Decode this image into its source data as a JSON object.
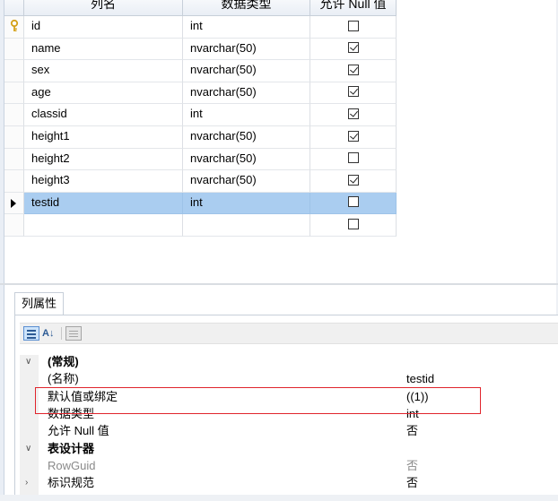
{
  "columns_grid": {
    "headers": {
      "name": "列名",
      "type": "数据类型",
      "nullable": "允许 Null 值"
    },
    "rows": [
      {
        "name": "id",
        "type": "int",
        "allow_null": false,
        "primary_key": true
      },
      {
        "name": "name",
        "type": "nvarchar(50)",
        "allow_null": true
      },
      {
        "name": "sex",
        "type": "nvarchar(50)",
        "allow_null": true
      },
      {
        "name": "age",
        "type": "nvarchar(50)",
        "allow_null": true
      },
      {
        "name": "classid",
        "type": "int",
        "allow_null": true
      },
      {
        "name": "height1",
        "type": "nvarchar(50)",
        "allow_null": true
      },
      {
        "name": "height2",
        "type": "nvarchar(50)",
        "allow_null": false
      },
      {
        "name": "height3",
        "type": "nvarchar(50)",
        "allow_null": true
      },
      {
        "name": "testid",
        "type": "int",
        "allow_null": false,
        "selected": true
      },
      {
        "name": "",
        "type": "",
        "allow_null": false
      }
    ]
  },
  "properties": {
    "tab_label": "列属性",
    "toolbar": {
      "sort_alpha_glyph": "A↓"
    },
    "rows": [
      {
        "kind": "category",
        "label": "(常规)"
      },
      {
        "kind": "prop",
        "label": "(名称)",
        "value": "testid"
      },
      {
        "kind": "prop",
        "label": "默认值或绑定",
        "value": "((1))"
      },
      {
        "kind": "prop",
        "label": "数据类型",
        "value": "int"
      },
      {
        "kind": "prop",
        "label": "允许 Null 值",
        "value": "否"
      },
      {
        "kind": "category",
        "label": "表设计器"
      },
      {
        "kind": "prop-gray",
        "label": "RowGuid",
        "value": "否"
      },
      {
        "kind": "prop-collapsed",
        "label": "标识规范",
        "value": "否"
      }
    ]
  },
  "colors": {
    "selected_row": "#aacdf0",
    "highlight_border": "#e0242c",
    "key_icon": "#d4a017"
  }
}
